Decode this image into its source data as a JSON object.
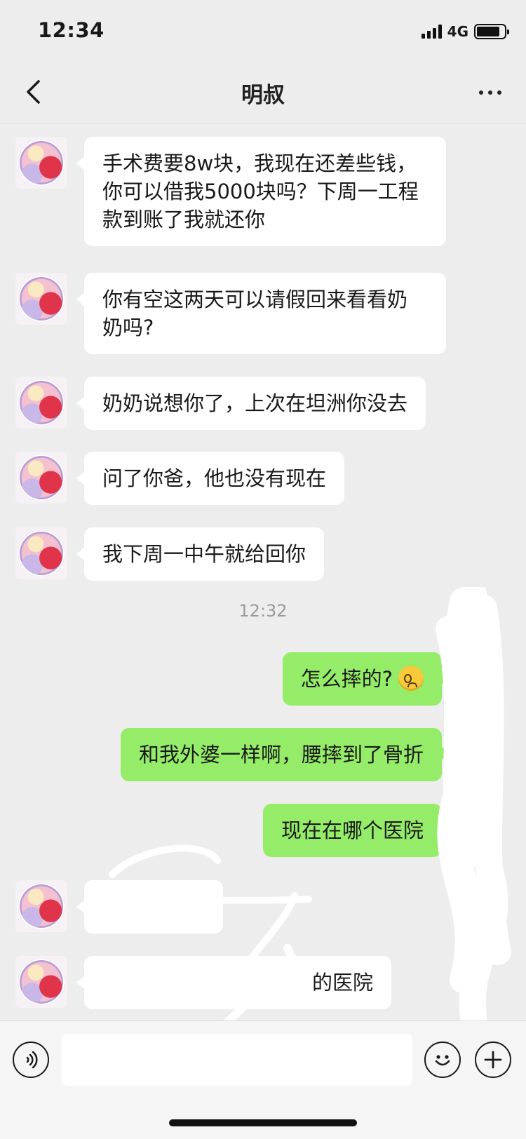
{
  "status_bar": {
    "time": "12:34",
    "network": "4G",
    "battery_level": 0.85
  },
  "nav": {
    "title": "明叔",
    "back_icon": "chevron-left-icon",
    "more_icon": "more-dots-icon"
  },
  "messages": {
    "m1": {
      "lines": [
        "手术费要8w块，我现在还差些钱，",
        "你可以借我5000块吗？下周一工程",
        "款到账了我就还你"
      ]
    },
    "m2": {
      "lines": [
        "你有空这两天可以请假回来看看奶",
        "奶吗?"
      ]
    },
    "m3": {
      "text": "奶奶说想你了，上次在坦洲你没去"
    },
    "m4": {
      "text": "问了你爸，他也没有现在"
    },
    "m5": {
      "text": "我下周一中午就给回你"
    },
    "timestamp": "12:32",
    "r1": {
      "text": "怎么摔的?",
      "emoji": "woozy-face-emoji"
    },
    "r2": {
      "text": "和我外婆一样啊，腰摔到了骨折"
    },
    "r3": {
      "text": "现在在哪个医院"
    },
    "m6": {
      "text": ""
    },
    "m7": {
      "text": "的医院"
    }
  },
  "input_bar": {
    "voice_icon": "voice-icon",
    "input_value": "",
    "emoji_icon": "smiley-icon",
    "plus_icon": "plus-icon"
  },
  "colors": {
    "background": "#ededed",
    "incoming_bubble": "#ffffff",
    "outgoing_bubble": "#95ec69",
    "timestamp": "#9a9a9a"
  }
}
